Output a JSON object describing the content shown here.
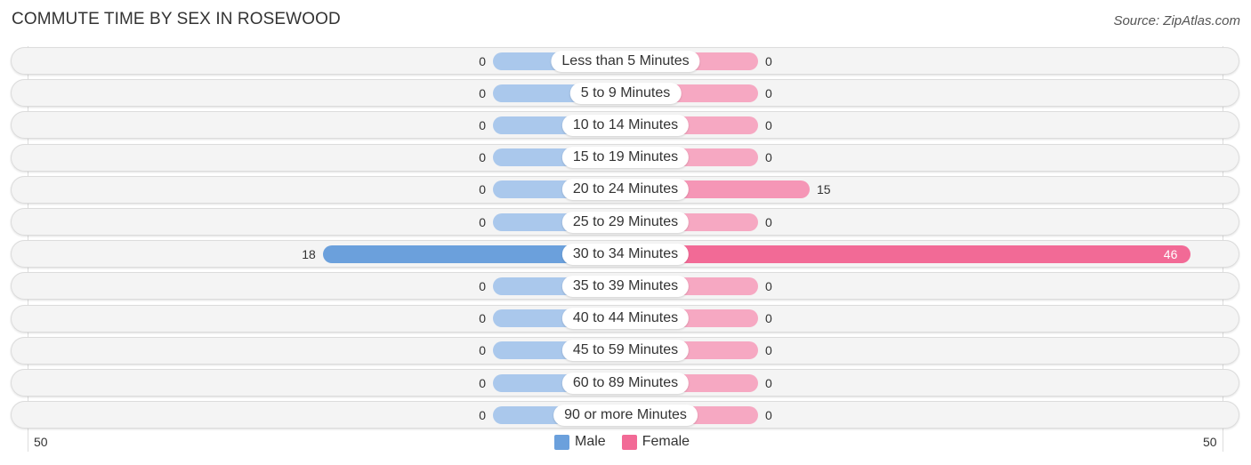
{
  "header": {
    "title": "COMMUTE TIME BY SEX IN ROSEWOOD",
    "source": "Source: ZipAtlas.com"
  },
  "colors": {
    "male_light": "#aac8ec",
    "male_strong": "#6ba0dc",
    "female_light": "#f6a8c2",
    "female_mid": "#f596b6",
    "female_strong": "#f26a96",
    "row_bg": "#f4f4f4"
  },
  "chart_data": {
    "type": "bar",
    "orientation": "horizontal-diverging",
    "title": "COMMUTE TIME BY SEX IN ROSEWOOD",
    "categories": [
      "Less than 5 Minutes",
      "5 to 9 Minutes",
      "10 to 14 Minutes",
      "15 to 19 Minutes",
      "20 to 24 Minutes",
      "25 to 29 Minutes",
      "30 to 34 Minutes",
      "35 to 39 Minutes",
      "40 to 44 Minutes",
      "45 to 59 Minutes",
      "60 to 89 Minutes",
      "90 or more Minutes"
    ],
    "series": [
      {
        "name": "Male",
        "values": [
          0,
          0,
          0,
          0,
          0,
          0,
          18,
          0,
          0,
          0,
          0,
          0
        ]
      },
      {
        "name": "Female",
        "values": [
          0,
          0,
          0,
          0,
          15,
          0,
          46,
          0,
          0,
          0,
          0,
          0
        ]
      }
    ],
    "axis": {
      "left_label": "50",
      "right_label": "50",
      "range": [
        -50,
        50
      ]
    },
    "legend": {
      "position": "bottom-center",
      "entries": [
        "Male",
        "Female"
      ]
    },
    "xlabel": "",
    "ylabel": ""
  }
}
